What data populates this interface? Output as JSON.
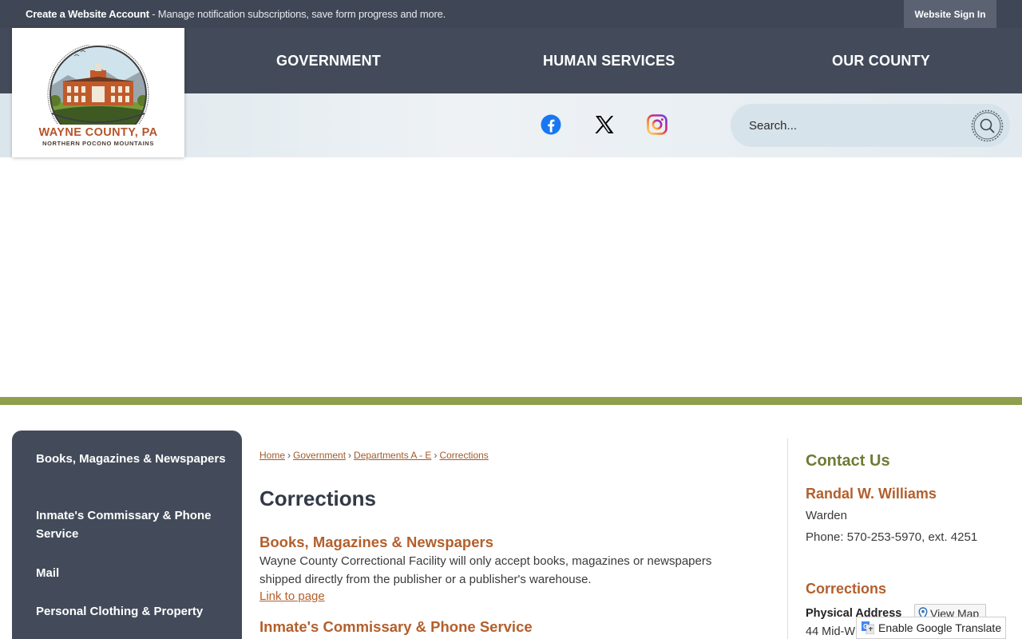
{
  "topbar": {
    "account_link": "Create a Website Account",
    "account_text": " - Manage notification subscriptions, save form progress and more.",
    "signin": "Website Sign In"
  },
  "logo": {
    "title": "WAYNE COUNTY, PA",
    "subtitle": "NORTHERN POCONO MOUNTAINS"
  },
  "nav": {
    "items": [
      {
        "label": "GOVERNMENT"
      },
      {
        "label": "HUMAN SERVICES"
      },
      {
        "label": "OUR COUNTY"
      }
    ]
  },
  "social": {
    "icons": [
      "facebook-icon",
      "x-twitter-icon",
      "instagram-icon"
    ],
    "colors": {
      "facebook": "#1877f2",
      "x": "#000000"
    }
  },
  "search": {
    "placeholder": "Search..."
  },
  "sidebar": {
    "items": [
      {
        "label": "Books, Magazines & Newspapers"
      },
      {
        "label": "Inmate's Commissary & Phone Service"
      },
      {
        "label": "Mail"
      },
      {
        "label": "Personal Clothing & Property"
      }
    ]
  },
  "breadcrumb": {
    "items": [
      "Home",
      "Government",
      "Departments A - E",
      "Corrections"
    ]
  },
  "page": {
    "title": "Corrections",
    "items": [
      {
        "title": "Books, Magazines & Newspapers",
        "description": "Wayne County Correctional Facility will only accept books, magazines or newspapers shipped directly from the publisher or a publisher's warehouse.",
        "link": "Link to page"
      },
      {
        "title": "Inmate's Commissary & Phone Service"
      }
    ]
  },
  "contact": {
    "heading": "Contact Us",
    "name": "Randal W. Williams",
    "role": "Warden",
    "phone": "Phone: 570-253-5970, ext. 4251",
    "department": "Corrections",
    "address_label": "Physical Address",
    "view_map": "View Map",
    "address_line": "44 Mid-W"
  },
  "translate": {
    "label": "Enable Google Translate"
  },
  "colors": {
    "nav_bg": "#434b5a",
    "topbar_bg": "#3f4756",
    "accent_orange": "#b35f2c",
    "accent_green": "#8fa04d",
    "contact_green": "#6f7b35"
  }
}
